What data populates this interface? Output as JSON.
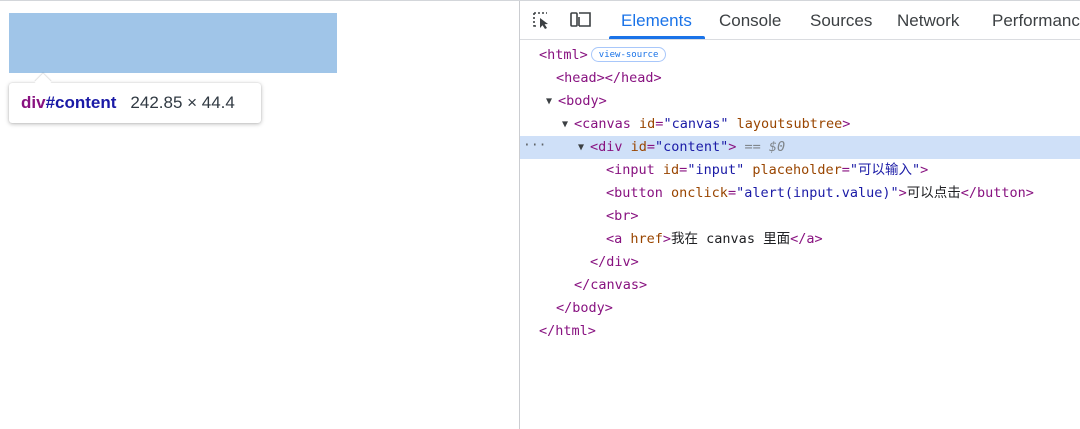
{
  "viewport": {
    "tooltip": {
      "tag": "div",
      "id": "#content",
      "size": "242.85 × 44.4"
    }
  },
  "toolbar": {
    "inspect_icon": "inspect-element-icon",
    "device_icon": "device-toolbar-icon",
    "tabs": [
      {
        "label": "Elements",
        "active": true
      },
      {
        "label": "Console",
        "active": false
      },
      {
        "label": "Sources",
        "active": false
      },
      {
        "label": "Network",
        "active": false
      },
      {
        "label": "Performance",
        "active": false
      }
    ]
  },
  "dom": {
    "html_open": "<html>",
    "view_source": "view-source",
    "head": "<head></head>",
    "body_open": "<body>",
    "canvas": {
      "open": "<canvas ",
      "attr1": "id",
      "val1": "\"canvas\"",
      "attr2": "layoutsubtree",
      "close": ">"
    },
    "div": {
      "open": "<div ",
      "attr": "id",
      "val": "\"content\"",
      "close": ">",
      "marker": "== $0",
      "ellipsis": "···"
    },
    "input": {
      "open": "<input ",
      "attr1": "id",
      "val1": "\"input\"",
      "attr2": "placeholder",
      "val2": "\"可以输入\"",
      "close": ">"
    },
    "button": {
      "open": "<button ",
      "attr": "onclick",
      "val": "\"alert(input.value)\"",
      "close": ">",
      "text": "可以点击",
      "end": "</button>"
    },
    "br": "<br>",
    "a": {
      "open": "<a ",
      "attr": "href",
      "close": ">",
      "text": "我在 canvas 里面",
      "end": "</a>"
    },
    "div_close": "</div>",
    "canvas_close": "</canvas>",
    "body_close": "</body>",
    "html_close": "</html>"
  },
  "colors": {
    "highlight": "#a0c5e8",
    "accent": "#1a73e8",
    "selected_row": "#cfe0f8",
    "tag": "#881280",
    "attr_name": "#994500",
    "attr_value": "#1a1aa6"
  }
}
